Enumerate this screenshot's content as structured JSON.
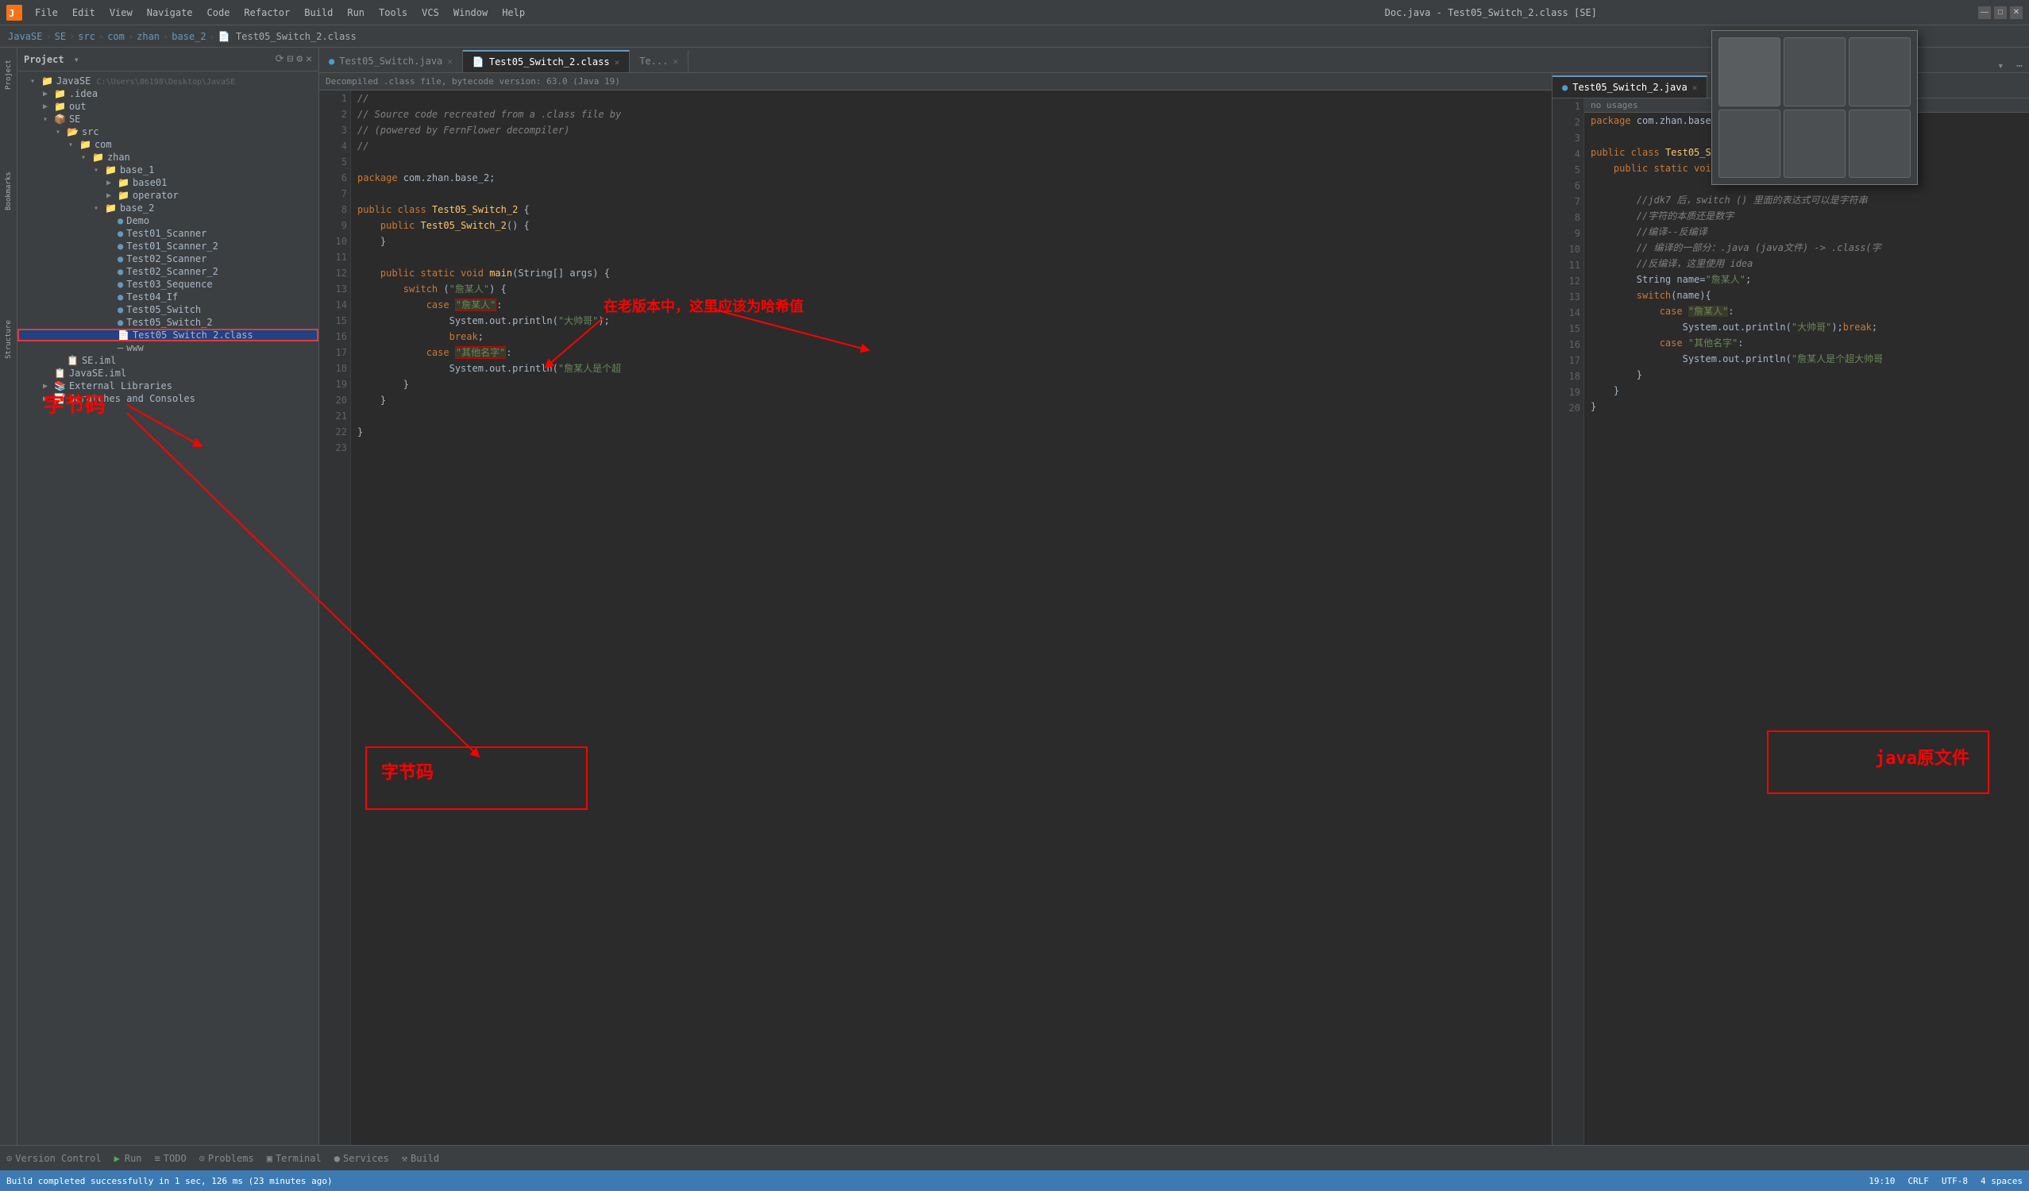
{
  "titleBar": {
    "title": "Doc.java - Test05_Switch_2.class [SE]",
    "menus": [
      "File",
      "Edit",
      "View",
      "Navigate",
      "Code",
      "Refactor",
      "Build",
      "Run",
      "Tools",
      "VCS",
      "Window",
      "Help"
    ],
    "controls": [
      "—",
      "□",
      "✕"
    ]
  },
  "breadcrumb": {
    "items": [
      "JavaSE",
      "SE",
      "src",
      "com",
      "zhan",
      "base_2",
      "Test05_Switch_2.class"
    ]
  },
  "projectPanel": {
    "title": "Project",
    "rootLabel": "JavaSE",
    "rootPath": "C:\\Users\\86198\\Desktop\\JavaSE",
    "items": [
      {
        "id": "idea",
        "label": ".idea",
        "depth": 1,
        "type": "folder",
        "collapsed": true
      },
      {
        "id": "out",
        "label": "out",
        "depth": 1,
        "type": "folder",
        "collapsed": true
      },
      {
        "id": "SE",
        "label": "SE",
        "depth": 1,
        "type": "folder",
        "collapsed": false
      },
      {
        "id": "src",
        "label": "src",
        "depth": 2,
        "type": "folder",
        "collapsed": false
      },
      {
        "id": "com",
        "label": "com",
        "depth": 3,
        "type": "folder",
        "collapsed": false
      },
      {
        "id": "zhan",
        "label": "zhan",
        "depth": 4,
        "type": "folder",
        "collapsed": false
      },
      {
        "id": "base_1",
        "label": "base_1",
        "depth": 5,
        "type": "folder",
        "collapsed": false
      },
      {
        "id": "base01",
        "label": "base01",
        "depth": 6,
        "type": "folder",
        "collapsed": true
      },
      {
        "id": "operator",
        "label": "operator",
        "depth": 6,
        "type": "folder",
        "collapsed": true
      },
      {
        "id": "base_2",
        "label": "base_2",
        "depth": 5,
        "type": "folder",
        "collapsed": false,
        "selected": false
      },
      {
        "id": "Demo",
        "label": "Demo",
        "depth": 6,
        "type": "java",
        "icon": "🔵"
      },
      {
        "id": "Test01_Scanner",
        "label": "Test01_Scanner",
        "depth": 6,
        "type": "java",
        "icon": "🔵"
      },
      {
        "id": "Test01_Scanner_2",
        "label": "Test01_Scanner_2",
        "depth": 6,
        "type": "java",
        "icon": "🔵"
      },
      {
        "id": "Test02_Scanner",
        "label": "Test02_Scanner",
        "depth": 6,
        "type": "java",
        "icon": "🔵"
      },
      {
        "id": "Test02_Scanner_2",
        "label": "Test02_Scanner_2",
        "depth": 6,
        "type": "java",
        "icon": "🔵"
      },
      {
        "id": "Test03_Sequence",
        "label": "Test03_Sequence",
        "depth": 6,
        "type": "java",
        "icon": "🔵"
      },
      {
        "id": "Test04_If",
        "label": "Test04_If",
        "depth": 6,
        "type": "java",
        "icon": "🔵"
      },
      {
        "id": "Test05_Switch",
        "label": "Test05_Switch",
        "depth": 6,
        "type": "java",
        "icon": "🔵"
      },
      {
        "id": "Test05_Switch_2",
        "label": "Test05_Switch_2",
        "depth": 6,
        "type": "java",
        "icon": "🔵"
      },
      {
        "id": "Test05_Switch_2_class",
        "label": "Test05_Switch_2.class",
        "depth": 6,
        "type": "class",
        "icon": "📄",
        "selected": true
      },
      {
        "id": "www",
        "label": "www",
        "depth": 6,
        "type": "file"
      },
      {
        "id": "SE_iml",
        "label": "SE.iml",
        "depth": 2,
        "type": "iml"
      },
      {
        "id": "JavaSE_iml",
        "label": "JavaSE.iml",
        "depth": 1,
        "type": "iml"
      },
      {
        "id": "ExternalLibraries",
        "label": "External Libraries",
        "depth": 1,
        "type": "lib",
        "collapsed": true
      },
      {
        "id": "ScratchesConsoles",
        "label": "Scratches and Consoles",
        "depth": 1,
        "type": "scratches",
        "collapsed": true
      }
    ]
  },
  "tabs": {
    "left": [
      {
        "label": "Test05_Switch.java",
        "active": false,
        "icon": "🔵"
      },
      {
        "label": "Test05_Switch_2.class",
        "active": true,
        "icon": "📄"
      },
      {
        "label": "Te...",
        "active": false
      }
    ],
    "right": [
      {
        "label": "Test05_Switch_2.java",
        "active": true,
        "icon": "🔵"
      }
    ]
  },
  "decompileNotice": "Decompiled .class file, bytecode version: 63.0 (Java 19)",
  "leftCode": {
    "lines": [
      {
        "n": 1,
        "text": "//"
      },
      {
        "n": 2,
        "text": "// Source code recreated from a .class file by"
      },
      {
        "n": 3,
        "text": "// (powered by FernFlower decompiler)"
      },
      {
        "n": 4,
        "text": "//"
      },
      {
        "n": 5,
        "text": ""
      },
      {
        "n": 6,
        "text": "package com.zhan.base_2;"
      },
      {
        "n": 7,
        "text": ""
      },
      {
        "n": 8,
        "text": "public class Test05_Switch_2 {"
      },
      {
        "n": 9,
        "text": "    public Test05_Switch_2() {"
      },
      {
        "n": 10,
        "text": "    }"
      },
      {
        "n": 11,
        "text": ""
      },
      {
        "n": 12,
        "text": "    public static void main(String[] args) {"
      },
      {
        "n": 13,
        "text": "        switch (\"詹某人\") {"
      },
      {
        "n": 14,
        "text": "            case \"詹某人\":"
      },
      {
        "n": 15,
        "text": "                System.out.println(\"大帅哥\");"
      },
      {
        "n": 16,
        "text": "                break;"
      },
      {
        "n": 17,
        "text": "            case \"其他名字\":"
      },
      {
        "n": 18,
        "text": "                System.out.println(\"詹某人是个超"
      },
      {
        "n": 19,
        "text": "        }"
      },
      {
        "n": 20,
        "text": "    }"
      },
      {
        "n": 21,
        "text": ""
      },
      {
        "n": 22,
        "text": "}"
      },
      {
        "n": 23,
        "text": ""
      }
    ]
  },
  "rightCode": {
    "noUsagesLabel": "no usages",
    "lines": [
      {
        "n": 1,
        "text": "package com.zhan.base_2;",
        "type": "normal"
      },
      {
        "n": 2,
        "text": "",
        "type": "normal"
      },
      {
        "n": 3,
        "text": "public class Test05_Switch {",
        "type": "normal"
      },
      {
        "n": 4,
        "text": "    public static void main(",
        "type": "normal"
      },
      {
        "n": 5,
        "text": "",
        "type": "normal"
      },
      {
        "n": 6,
        "text": "        //jdk7 后，switch () 里面的表达式可以是字符串",
        "type": "comment"
      },
      {
        "n": 7,
        "text": "        //字符的本质还是数字",
        "type": "comment"
      },
      {
        "n": 8,
        "text": "        //编译--反编译",
        "type": "comment"
      },
      {
        "n": 9,
        "text": "        // 编译的一部分：.java (java文件) -> .class(字",
        "type": "comment"
      },
      {
        "n": 10,
        "text": "        //反编译，这里使用 idea",
        "type": "comment"
      },
      {
        "n": 11,
        "text": "        String name=\"詹某人\";",
        "type": "normal"
      },
      {
        "n": 12,
        "text": "        switch(name){",
        "type": "normal"
      },
      {
        "n": 13,
        "text": "            case \"詹某人\":",
        "type": "normal"
      },
      {
        "n": 14,
        "text": "                System.out.println(\"大帅哥\");break;",
        "type": "normal"
      },
      {
        "n": 15,
        "text": "            case \"其他名字\":",
        "type": "normal"
      },
      {
        "n": 16,
        "text": "                System.out.println(\"詹某人是个超大帅哥",
        "type": "normal"
      },
      {
        "n": 17,
        "text": "        }",
        "type": "normal"
      },
      {
        "n": 18,
        "text": "    }",
        "type": "normal"
      },
      {
        "n": 19,
        "text": "}",
        "type": "normal"
      },
      {
        "n": 20,
        "text": "",
        "type": "normal"
      }
    ]
  },
  "bottomBar": {
    "items": [
      {
        "icon": "⊙",
        "label": "Version Control"
      },
      {
        "icon": "▶",
        "label": "Run"
      },
      {
        "icon": "≡",
        "label": "TODO"
      },
      {
        "icon": "⚠",
        "label": "Problems"
      },
      {
        "icon": "▣",
        "label": "Terminal"
      },
      {
        "icon": "●",
        "label": "Services"
      },
      {
        "icon": "⚒",
        "label": "Build"
      }
    ]
  },
  "statusBar": {
    "leftText": "Build completed successfully in 1 sec, 126 ms (23 minutes ago)",
    "position": "19:10",
    "lineEnding": "CRLF",
    "encoding": "UTF-8",
    "indent": "4 spaces"
  },
  "annotations": {
    "bytecode_label": "字节码",
    "javafile_label": "java原文件",
    "hashvalue_label": "在老版本中，这里应该为哈希值"
  },
  "popupCells": 6
}
